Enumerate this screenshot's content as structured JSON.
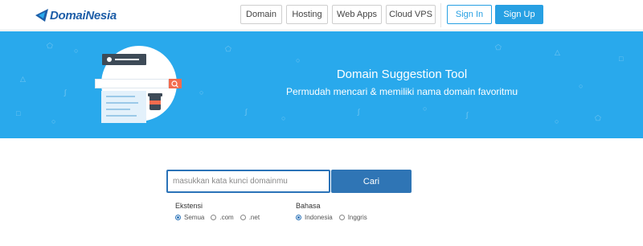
{
  "brand": {
    "name": "DomaiNesia",
    "color": "#1e5ea8"
  },
  "nav": {
    "items": [
      {
        "label": "Domain"
      },
      {
        "label": "Hosting"
      },
      {
        "label": "Web Apps"
      },
      {
        "label": "Cloud VPS"
      }
    ],
    "signin_label": "Sign In",
    "signup_label": "Sign Up",
    "accent": "#27a0e3"
  },
  "hero": {
    "title": "Domain Suggestion Tool",
    "subtitle": "Permudah mencari & memiliki nama domain favoritmu",
    "background": "#29a9ec"
  },
  "search": {
    "placeholder": "masukkan kata kunci domainmu",
    "button_label": "Cari"
  },
  "options": {
    "extension": {
      "label": "Ekstensi",
      "choices": [
        "Semua",
        ".com",
        ".net"
      ],
      "selected": "Semua"
    },
    "language": {
      "label": "Bahasa",
      "choices": [
        "Indonesia",
        "Inggris"
      ],
      "selected": "Indonesia"
    }
  }
}
